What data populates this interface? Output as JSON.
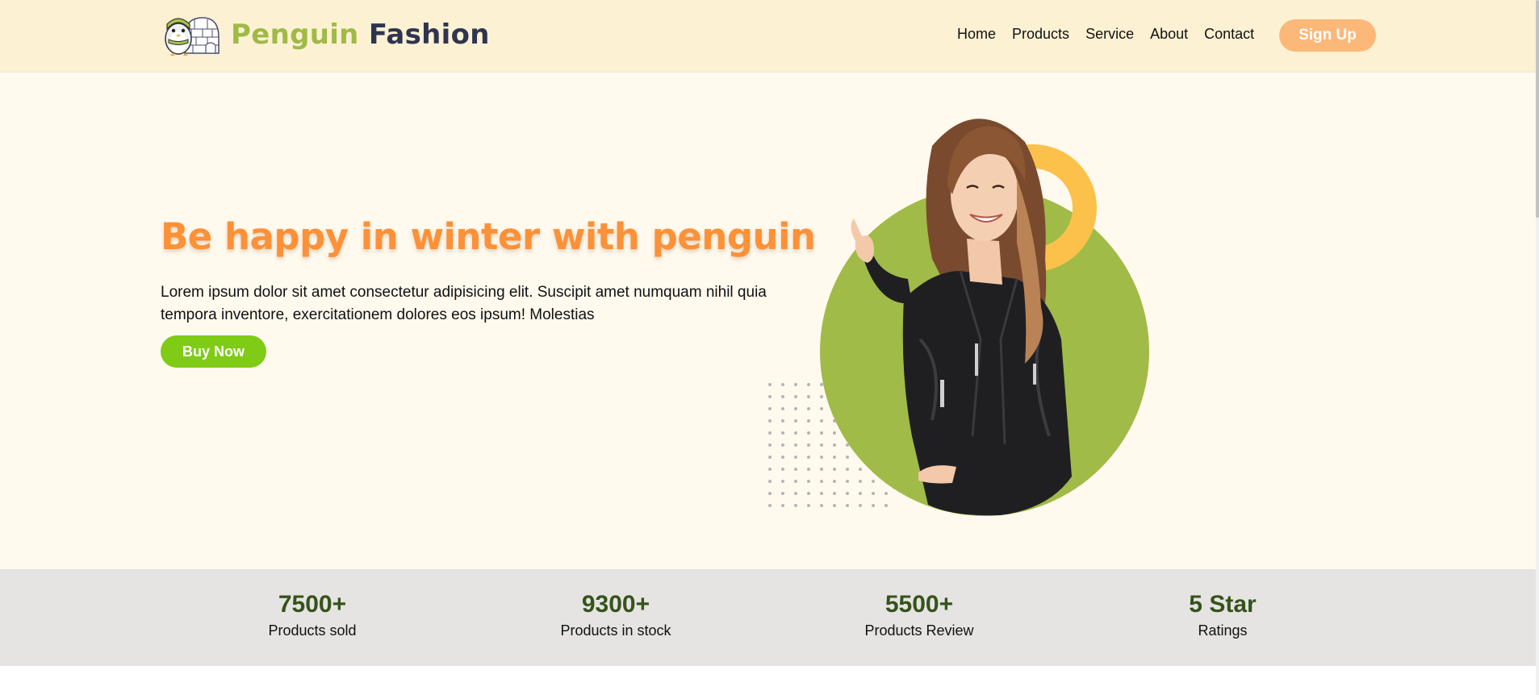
{
  "brand": {
    "part1": "Penguin",
    "part2": "Fashion",
    "logo_icon": "penguin-igloo-logo"
  },
  "nav": {
    "items": [
      "Home",
      "Products",
      "Service",
      "About",
      "Contact"
    ],
    "signup": "Sign Up"
  },
  "hero": {
    "headline": "Be happy in winter with penguin",
    "paragraph": "Lorem ipsum dolor sit amet consectetur adipisicing elit. Suscipit amet numquam nihil quia tempora inventore, exercitationem dolores eos ipsum! Molestias",
    "button": "Buy Now"
  },
  "stats": [
    {
      "value": "7500+",
      "label": "Products sold"
    },
    {
      "value": "9300+",
      "label": "Products in stock"
    },
    {
      "value": "5500+",
      "label": "Products Review"
    },
    {
      "value": "5 Star",
      "label": "Ratings"
    }
  ],
  "colors": {
    "header_bg": "#fdf1d3",
    "hero_bg": "#fff9ee",
    "accent_orange": "#fc9138",
    "brand_green": "#9fba47",
    "brand_navy": "#2f3550",
    "button_green": "#7fcb16",
    "signup_bg": "#fcb879",
    "stat_green": "#35531a",
    "circle_green": "#a0bb48",
    "ring_yellow": "#fcc14a"
  }
}
